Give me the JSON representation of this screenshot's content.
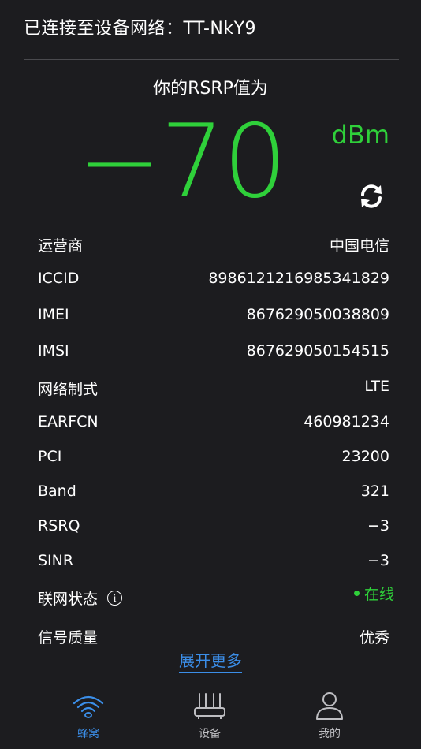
{
  "header": {
    "title": "已连接至设备网络：TT-NkY9"
  },
  "rsrp": {
    "title": "你的RSRP值为",
    "value": "−70",
    "unit": "dBm"
  },
  "details": [
    {
      "label": "运营商",
      "value": "中国电信"
    },
    {
      "label": "ICCID",
      "value": "89861212169853418​29"
    },
    {
      "label": "IMEI",
      "value": "867629050038809"
    },
    {
      "label": "IMSI",
      "value": "867629050154515"
    },
    {
      "label": "网络制式",
      "value": "LTE"
    },
    {
      "label": "EARFCN",
      "value": "460981234"
    },
    {
      "label": "PCI",
      "value": "23200"
    },
    {
      "label": "Band",
      "value": "321"
    },
    {
      "label": "RSRQ",
      "value": "−3"
    },
    {
      "label": "SINR",
      "value": "−3"
    },
    {
      "label": "联网状态",
      "value": "在线"
    },
    {
      "label": "信号质量",
      "value": "优秀"
    }
  ],
  "expand_label": "展开更多",
  "tabs": [
    {
      "label": "蜂窝",
      "icon": "wifi-icon",
      "active": true
    },
    {
      "label": "设备",
      "icon": "router-icon",
      "active": false
    },
    {
      "label": "我的",
      "icon": "user-icon",
      "active": false
    }
  ],
  "colors": {
    "accent_green": "#2fd03a",
    "accent_blue": "#3b8ee8",
    "background": "#1c1c1f"
  }
}
